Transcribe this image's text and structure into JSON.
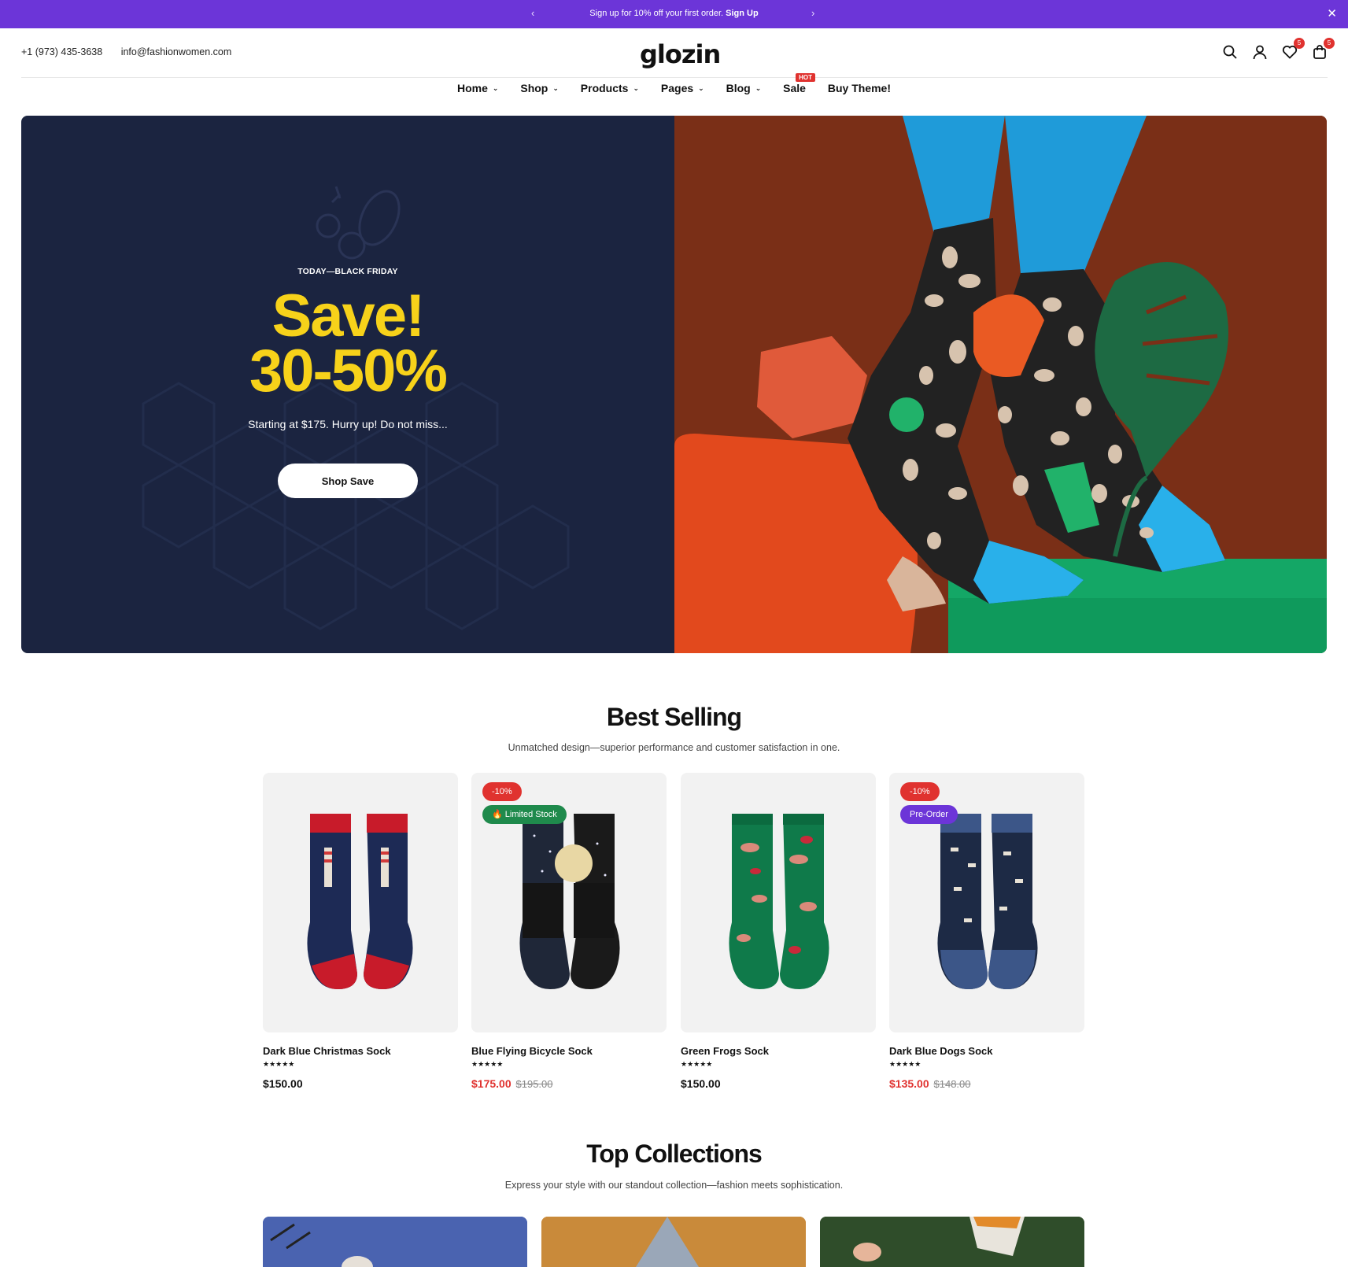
{
  "announcement": {
    "text": "Sign up for 10% off your first order.",
    "link": "Sign Up",
    "prev": "‹",
    "next": "›",
    "close": "✕"
  },
  "header": {
    "phone": "+1 (973) 435-3638",
    "email": "info@fashionwomen.com",
    "logo": "glozin",
    "wishlist_count": "5",
    "cart_count": "5"
  },
  "nav": {
    "items": [
      {
        "label": "Home"
      },
      {
        "label": "Shop"
      },
      {
        "label": "Products"
      },
      {
        "label": "Pages"
      },
      {
        "label": "Blog"
      },
      {
        "label": "Sale"
      },
      {
        "label": "Buy Theme!"
      }
    ],
    "hot_badge": "HOT"
  },
  "hero": {
    "eyebrow": "TODAY—BLACK FRIDAY",
    "line1": "Save!",
    "line2": "30-50%",
    "subtitle": "Starting at $175. Hurry up! Do not miss...",
    "button": "Shop Save"
  },
  "best_selling": {
    "title": "Best Selling",
    "subtitle": "Unmatched design—superior performance and customer satisfaction in one.",
    "products": [
      {
        "name": "Dark Blue Christmas Sock",
        "stars": "★★★★★",
        "price": "$150.00",
        "old_price": "",
        "discount": "",
        "tag": ""
      },
      {
        "name": "Blue Flying Bicycle Sock",
        "stars": "★★★★★",
        "price": "$175.00",
        "old_price": "$195.00",
        "discount": "-10%",
        "tag": "🔥 Limited Stock"
      },
      {
        "name": "Green Frogs Sock",
        "stars": "★★★★★",
        "price": "$150.00",
        "old_price": "",
        "discount": "",
        "tag": ""
      },
      {
        "name": "Dark Blue Dogs Sock",
        "stars": "★★★★★",
        "price": "$135.00",
        "old_price": "$148.00",
        "discount": "-10%",
        "tag": "Pre-Order"
      }
    ]
  },
  "top_collections": {
    "title": "Top Collections",
    "subtitle": "Express your style with our standout collection—fashion meets sophistication."
  },
  "colors": {
    "accent": "#6c35d8",
    "hero_bg": "#1b2440",
    "hero_text": "#f7d21a",
    "sale": "#e0322f",
    "limited": "#1f8a4c"
  }
}
